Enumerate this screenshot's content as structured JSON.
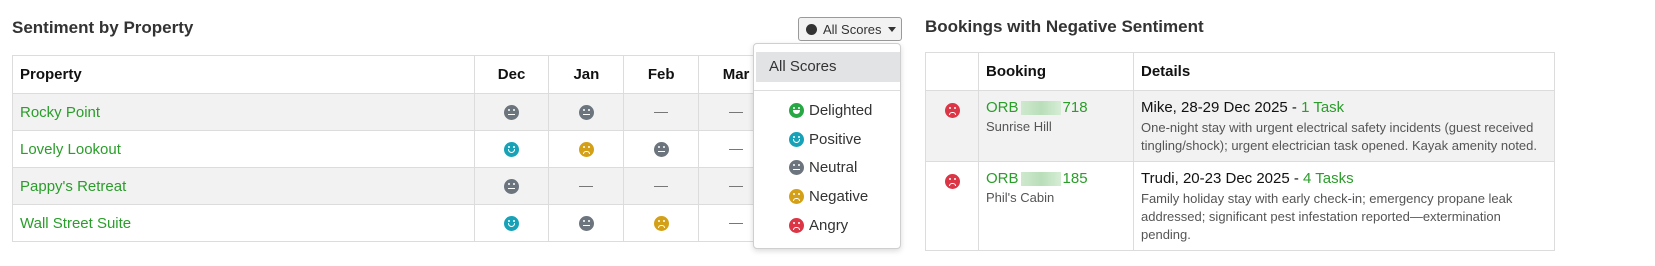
{
  "left": {
    "title": "Sentiment by Property",
    "filter_label": "All Scores",
    "columns": [
      "Property",
      "Dec",
      "Jan",
      "Feb",
      "Mar"
    ],
    "rows": [
      {
        "name": "Rocky Point",
        "cells": [
          "neutral",
          "neutral",
          "dash",
          "dash"
        ]
      },
      {
        "name": "Lovely Lookout",
        "cells": [
          "positive",
          "negative",
          "neutral",
          "dash"
        ]
      },
      {
        "name": "Pappy's Retreat",
        "cells": [
          "neutral",
          "dash",
          "dash",
          "dash"
        ]
      },
      {
        "name": "Wall Street Suite",
        "cells": [
          "positive",
          "neutral",
          "negative",
          "dash"
        ]
      }
    ]
  },
  "dropdown": {
    "all_label": "All Scores",
    "items": [
      {
        "label": "Delighted",
        "icon": "delighted-face-icon"
      },
      {
        "label": "Positive",
        "icon": "positive-face-icon"
      },
      {
        "label": "Neutral",
        "icon": "neutral-face-icon"
      },
      {
        "label": "Negative",
        "icon": "negative-face-icon"
      },
      {
        "label": "Angry",
        "icon": "angry-face-icon"
      }
    ]
  },
  "right": {
    "title": "Bookings with Negative Sentiment",
    "columns": [
      "",
      "Booking",
      "Details"
    ],
    "rows": [
      {
        "ref_prefix": "ORB",
        "ref_suffix": "718",
        "property": "Sunrise Hill",
        "guest_dates": "Mike, 28-29 Dec 2025 - ",
        "tasks": "1 Task",
        "details": "One-night stay with urgent electrical safety incidents (guest received tingling/shock); urgent electrician task opened. Kayak amenity noted."
      },
      {
        "ref_prefix": "ORB",
        "ref_suffix": "185",
        "property": "Phil's Cabin",
        "guest_dates": "Trudi, 20-23 Dec 2025 - ",
        "tasks": "4 Tasks",
        "details": "Family holiday stay with early check-in; emergency propane leak addressed; significant pest infestation reported—extermination pending."
      }
    ]
  },
  "colors": {
    "link_green": "#2a9d2a",
    "neutral": "#6c757d",
    "positive": "#17a2b8",
    "negative": "#d4a017",
    "angry": "#dc3545",
    "delighted": "#28a745"
  }
}
